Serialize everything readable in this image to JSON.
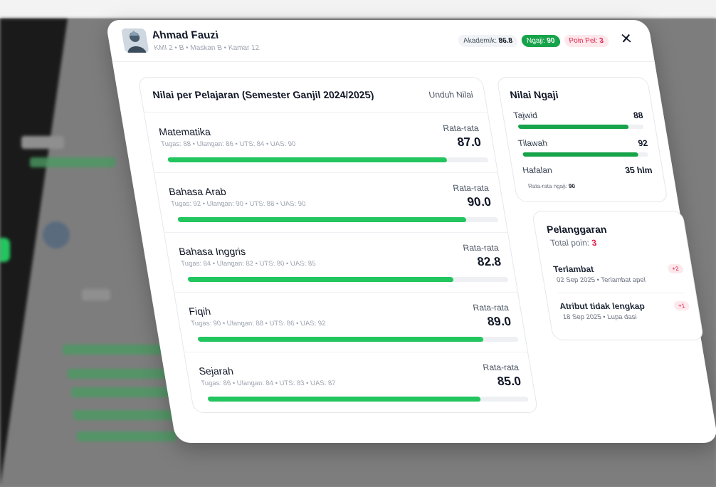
{
  "student": {
    "name": "Ahmad Fauzi",
    "meta": "KMI 2 • B • Maskan B • Kamar 12"
  },
  "badges": {
    "akademik_label": "Akademik:",
    "akademik_value": "86.8",
    "ngaji_label": "Ngaji:",
    "ngaji_value": "90",
    "poin_label": "Poin Pel:",
    "poin_value": "3"
  },
  "close_label": "✕",
  "nilai": {
    "title": "Nilai per Pelajaran (Semester Ganjil 2024/2025)",
    "download_label": "Unduh Nilai",
    "avg_label": "Rata-rata",
    "subjects": [
      {
        "name": "Matematika",
        "detail": "Tugas: 88 • Ulangan: 86 • UTS: 84 • UAS: 90",
        "average": "87.0",
        "progress": 87.0
      },
      {
        "name": "Bahasa Arab",
        "detail": "Tugas: 92 • Ulangan: 90 • UTS: 88 • UAS: 90",
        "average": "90.0",
        "progress": 90.0
      },
      {
        "name": "Bahasa Inggris",
        "detail": "Tugas: 84 • Ulangan: 82 • UTS: 80 • UAS: 85",
        "average": "82.8",
        "progress": 82.8
      },
      {
        "name": "Fiqih",
        "detail": "Tugas: 90 • Ulangan: 88 • UTS: 86 • UAS: 92",
        "average": "89.0",
        "progress": 89.0
      },
      {
        "name": "Sejarah",
        "detail": "Tugas: 86 • Ulangan: 84 • UTS: 83 • UAS: 87",
        "average": "85.0",
        "progress": 85.0
      }
    ]
  },
  "ngaji": {
    "title": "Nilai Ngaji",
    "items": [
      {
        "label": "Tajwid",
        "value": "88",
        "progress": 88
      },
      {
        "label": "Tilawah",
        "value": "92",
        "progress": 92
      },
      {
        "label": "Hafalan",
        "value": "35 hlm"
      }
    ],
    "avg_label": "Rata-rata ngaji:",
    "avg_value": "90"
  },
  "pelanggaran": {
    "title": "Pelanggaran",
    "total_label": "Total poin:",
    "total_value": "3",
    "items": [
      {
        "name": "Terlambat",
        "detail": "02 Sep 2025 • Terlambat apel",
        "points": "+2"
      },
      {
        "name": "Atribut tidak lengkap",
        "detail": "18 Sep 2025 • Lupa dasi",
        "points": "+1"
      }
    ]
  },
  "colors": {
    "accent_green": "#22c55e",
    "ngaji_green": "#16a34a",
    "danger": "#e11d48"
  },
  "icons": {
    "avatar": "student-avatar-icon",
    "close": "close-icon"
  }
}
